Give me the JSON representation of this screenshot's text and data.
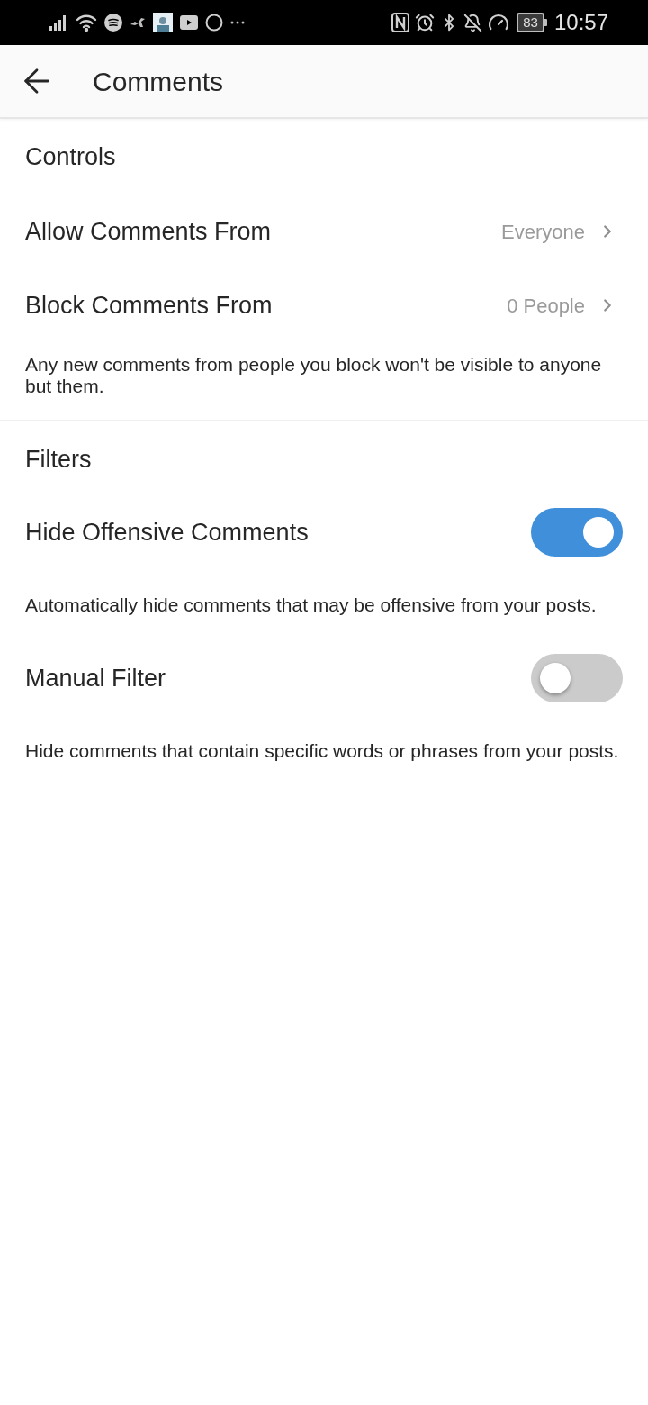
{
  "status_bar": {
    "battery": "83",
    "time": "10:57"
  },
  "header": {
    "title": "Comments"
  },
  "sections": [
    {
      "title": "Controls",
      "rows": [
        {
          "kind": "link",
          "label": "Allow Comments From",
          "value": "Everyone"
        },
        {
          "kind": "link",
          "label": "Block Comments From",
          "value": "0 People",
          "note": "Any new comments from people you block won't be visible to anyone but them."
        }
      ]
    },
    {
      "title": "Filters",
      "rows": [
        {
          "kind": "toggle",
          "label": "Hide Offensive Comments",
          "on": true,
          "note": "Automatically hide comments that may be offensive from your posts."
        },
        {
          "kind": "toggle",
          "label": "Manual Filter",
          "on": false,
          "note": "Hide comments that contain specific words or phrases from your posts."
        }
      ]
    }
  ]
}
